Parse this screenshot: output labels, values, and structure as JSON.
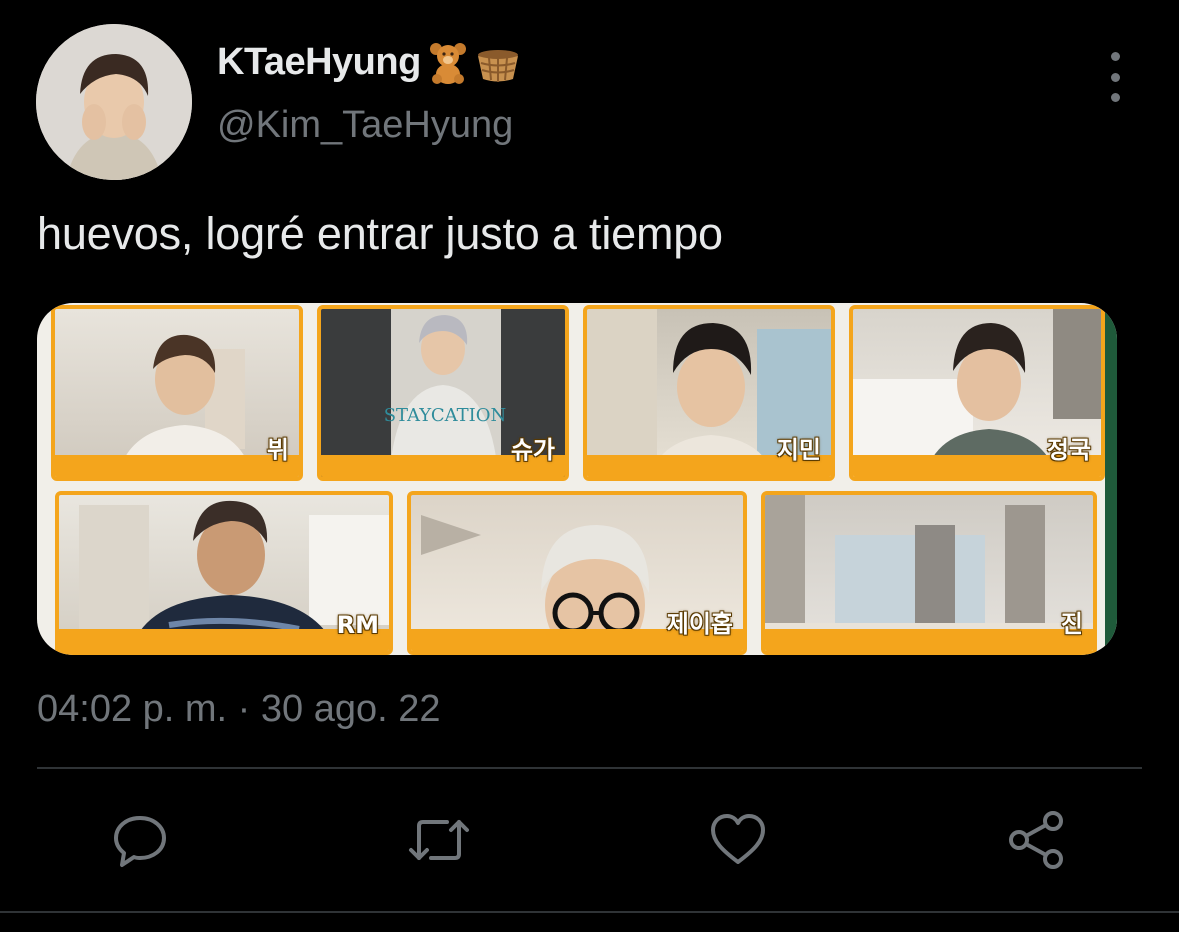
{
  "tweet": {
    "display_name": "KTaeHyung",
    "name_emojis": [
      "teddy-bear-emoji",
      "basket-emoji"
    ],
    "handle": "@Kim_TaeHyung",
    "text": "huevos, logré entrar justo a tiempo",
    "timestamp": "04:02 p. m. · 30 ago. 22"
  },
  "media": {
    "tiles": [
      {
        "label": "뷔"
      },
      {
        "label": "슈가"
      },
      {
        "label": "지민"
      },
      {
        "label": "정국"
      },
      {
        "label": "RM"
      },
      {
        "label": "제이홉"
      },
      {
        "label": "진"
      }
    ],
    "accent_color": "#f4a51c"
  },
  "actions": {
    "reply": "reply-icon",
    "retweet": "retweet-icon",
    "like": "heart-icon",
    "share": "share-icon"
  },
  "colors": {
    "background": "#000000",
    "primary_text": "#e7e9ea",
    "secondary_text": "#71767b",
    "divider": "#2f3336"
  }
}
